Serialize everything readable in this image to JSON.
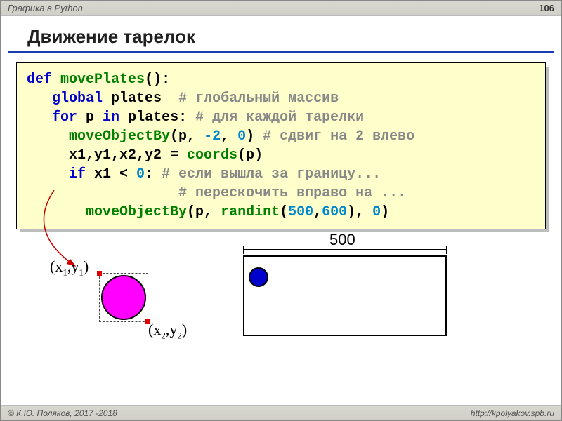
{
  "header": {
    "breadcrumb": "Графика в Python",
    "page": "106"
  },
  "title": "Движение тарелок",
  "code": {
    "l1_def": "def",
    "l1_fn": "movePlates",
    "l1_tail": "():",
    "l2_kw": "global",
    "l2_var": " plates  ",
    "l2_cmt": "# глобальный массив",
    "l3_for": "for",
    "l3_p": " p ",
    "l3_in": "in",
    "l3_rest": " plates: ",
    "l3_cmt": "# для каждой тарелки",
    "l4_fn": "moveObjectBy",
    "l4_open": "(p, ",
    "l4_n1": "-2",
    "l4_mid": ", ",
    "l4_n2": "0",
    "l4_close": ") ",
    "l4_cmt": "# сдвиг на 2 влево",
    "l5_lhs": "x1,y1,x2,y2 = ",
    "l5_fn": "coords",
    "l5_tail": "(p)",
    "l6_if": "if",
    "l6_a": " x1 < ",
    "l6_n": "0",
    "l6_b": ": ",
    "l6_cmt": "# если вышла за границу...",
    "l7_cmt": "# перескочить вправо на ...",
    "l8_fn": "moveObjectBy",
    "l8_a": "(p, ",
    "l8_fn2": "randint",
    "l8_b": "(",
    "l8_n1": "500",
    "l8_c": ",",
    "l8_n2": "600",
    "l8_d": "), ",
    "l8_n3": "0",
    "l8_e": ")"
  },
  "diagram": {
    "coord1_a": "(x",
    "coord1_s1": "1",
    "coord1_b": ",y",
    "coord1_s2": "1",
    "coord1_c": ")",
    "coord2_a": "(x",
    "coord2_s1": "2",
    "coord2_b": ",y",
    "coord2_s2": "2",
    "coord2_c": ")",
    "width_label": "500"
  },
  "footer": {
    "copyright": "© К.Ю. Поляков, 2017 -2018",
    "url": "http://kpolyakov.spb.ru"
  }
}
